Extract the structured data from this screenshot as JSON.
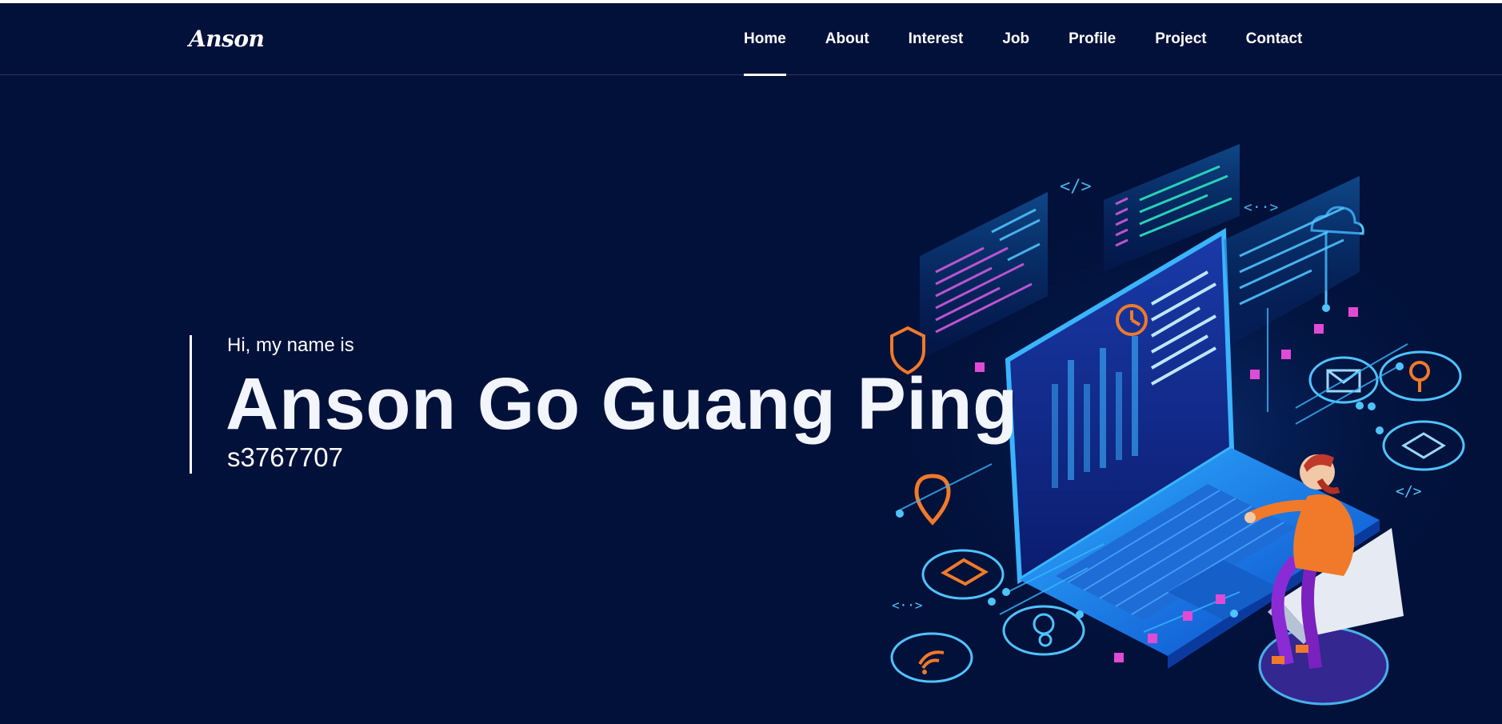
{
  "header": {
    "logo": "Anson",
    "nav": [
      {
        "label": "Home",
        "active": true
      },
      {
        "label": "About",
        "active": false
      },
      {
        "label": "Interest",
        "active": false
      },
      {
        "label": "Job",
        "active": false
      },
      {
        "label": "Profile",
        "active": false
      },
      {
        "label": "Project",
        "active": false
      },
      {
        "label": "Contact",
        "active": false
      }
    ]
  },
  "hero": {
    "greeting": "Hi, my name is",
    "name": "Anson Go Guang Ping",
    "student_id": "s3767707",
    "illustration": "isometric-developer-laptop-illustration"
  },
  "colors": {
    "background": "#01113a",
    "text": "#ffffff",
    "accent_cyan": "#3ab4ff",
    "accent_pink": "#e04bd6",
    "accent_orange": "#f07a2a"
  }
}
